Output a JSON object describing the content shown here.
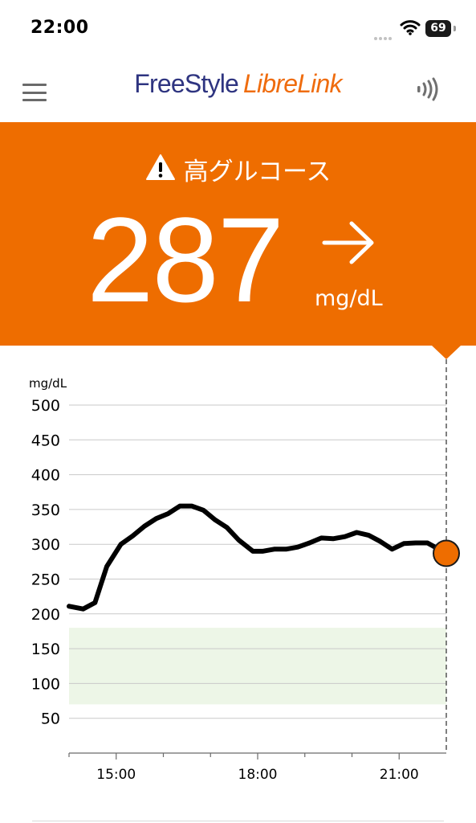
{
  "status_bar": {
    "time": "22:00",
    "battery_level": "69",
    "icons": [
      "cellular-dots-icon",
      "wifi-icon",
      "battery-icon"
    ]
  },
  "header": {
    "brand_part1": "FreeStyle",
    "brand_part2": "LibreLink",
    "icons": [
      "menu-icon",
      "nfc-scan-icon"
    ]
  },
  "banner": {
    "alert_text": "高グルコース",
    "value": "287",
    "unit": "mg/dL",
    "trend": "steady-arrow-icon",
    "color": "#ee6d00"
  },
  "colors": {
    "accent": "#ee6d00",
    "brand_blue": "#2e3480",
    "brand_orange": "#ef6c0e",
    "target_range_fill": "#edf6e7"
  },
  "chart_data": {
    "type": "line",
    "ylabel": "mg/dL",
    "ylim": [
      0,
      500
    ],
    "y_ticks": [
      50,
      100,
      150,
      200,
      250,
      300,
      350,
      400,
      450,
      500
    ],
    "x_tick_labels": [
      "15:00",
      "18:00",
      "21:00"
    ],
    "x_tick_hours": [
      15,
      18,
      21
    ],
    "xlim_hours": [
      14.0,
      22.0
    ],
    "target_range": [
      70,
      180
    ],
    "current_point": {
      "x_hours": 22.0,
      "y": 287
    },
    "series": [
      {
        "x_hours": [
          14.0,
          14.3,
          14.55,
          14.8,
          15.1,
          15.35,
          15.6,
          15.85,
          16.1,
          16.35,
          16.6,
          16.85,
          17.1,
          17.35,
          17.6,
          17.9,
          18.1,
          18.35,
          18.6,
          18.85,
          19.1,
          19.35,
          19.6,
          19.85,
          20.1,
          20.35,
          20.6,
          20.85,
          21.1,
          21.35,
          21.6
        ],
        "values": [
          211,
          207,
          216,
          268,
          300,
          312,
          326,
          337,
          344,
          355,
          355,
          349,
          335,
          324,
          306,
          290,
          290,
          293,
          293,
          296,
          302,
          309,
          308,
          311,
          317,
          313,
          304,
          293,
          301,
          302,
          302
        ]
      }
    ]
  }
}
